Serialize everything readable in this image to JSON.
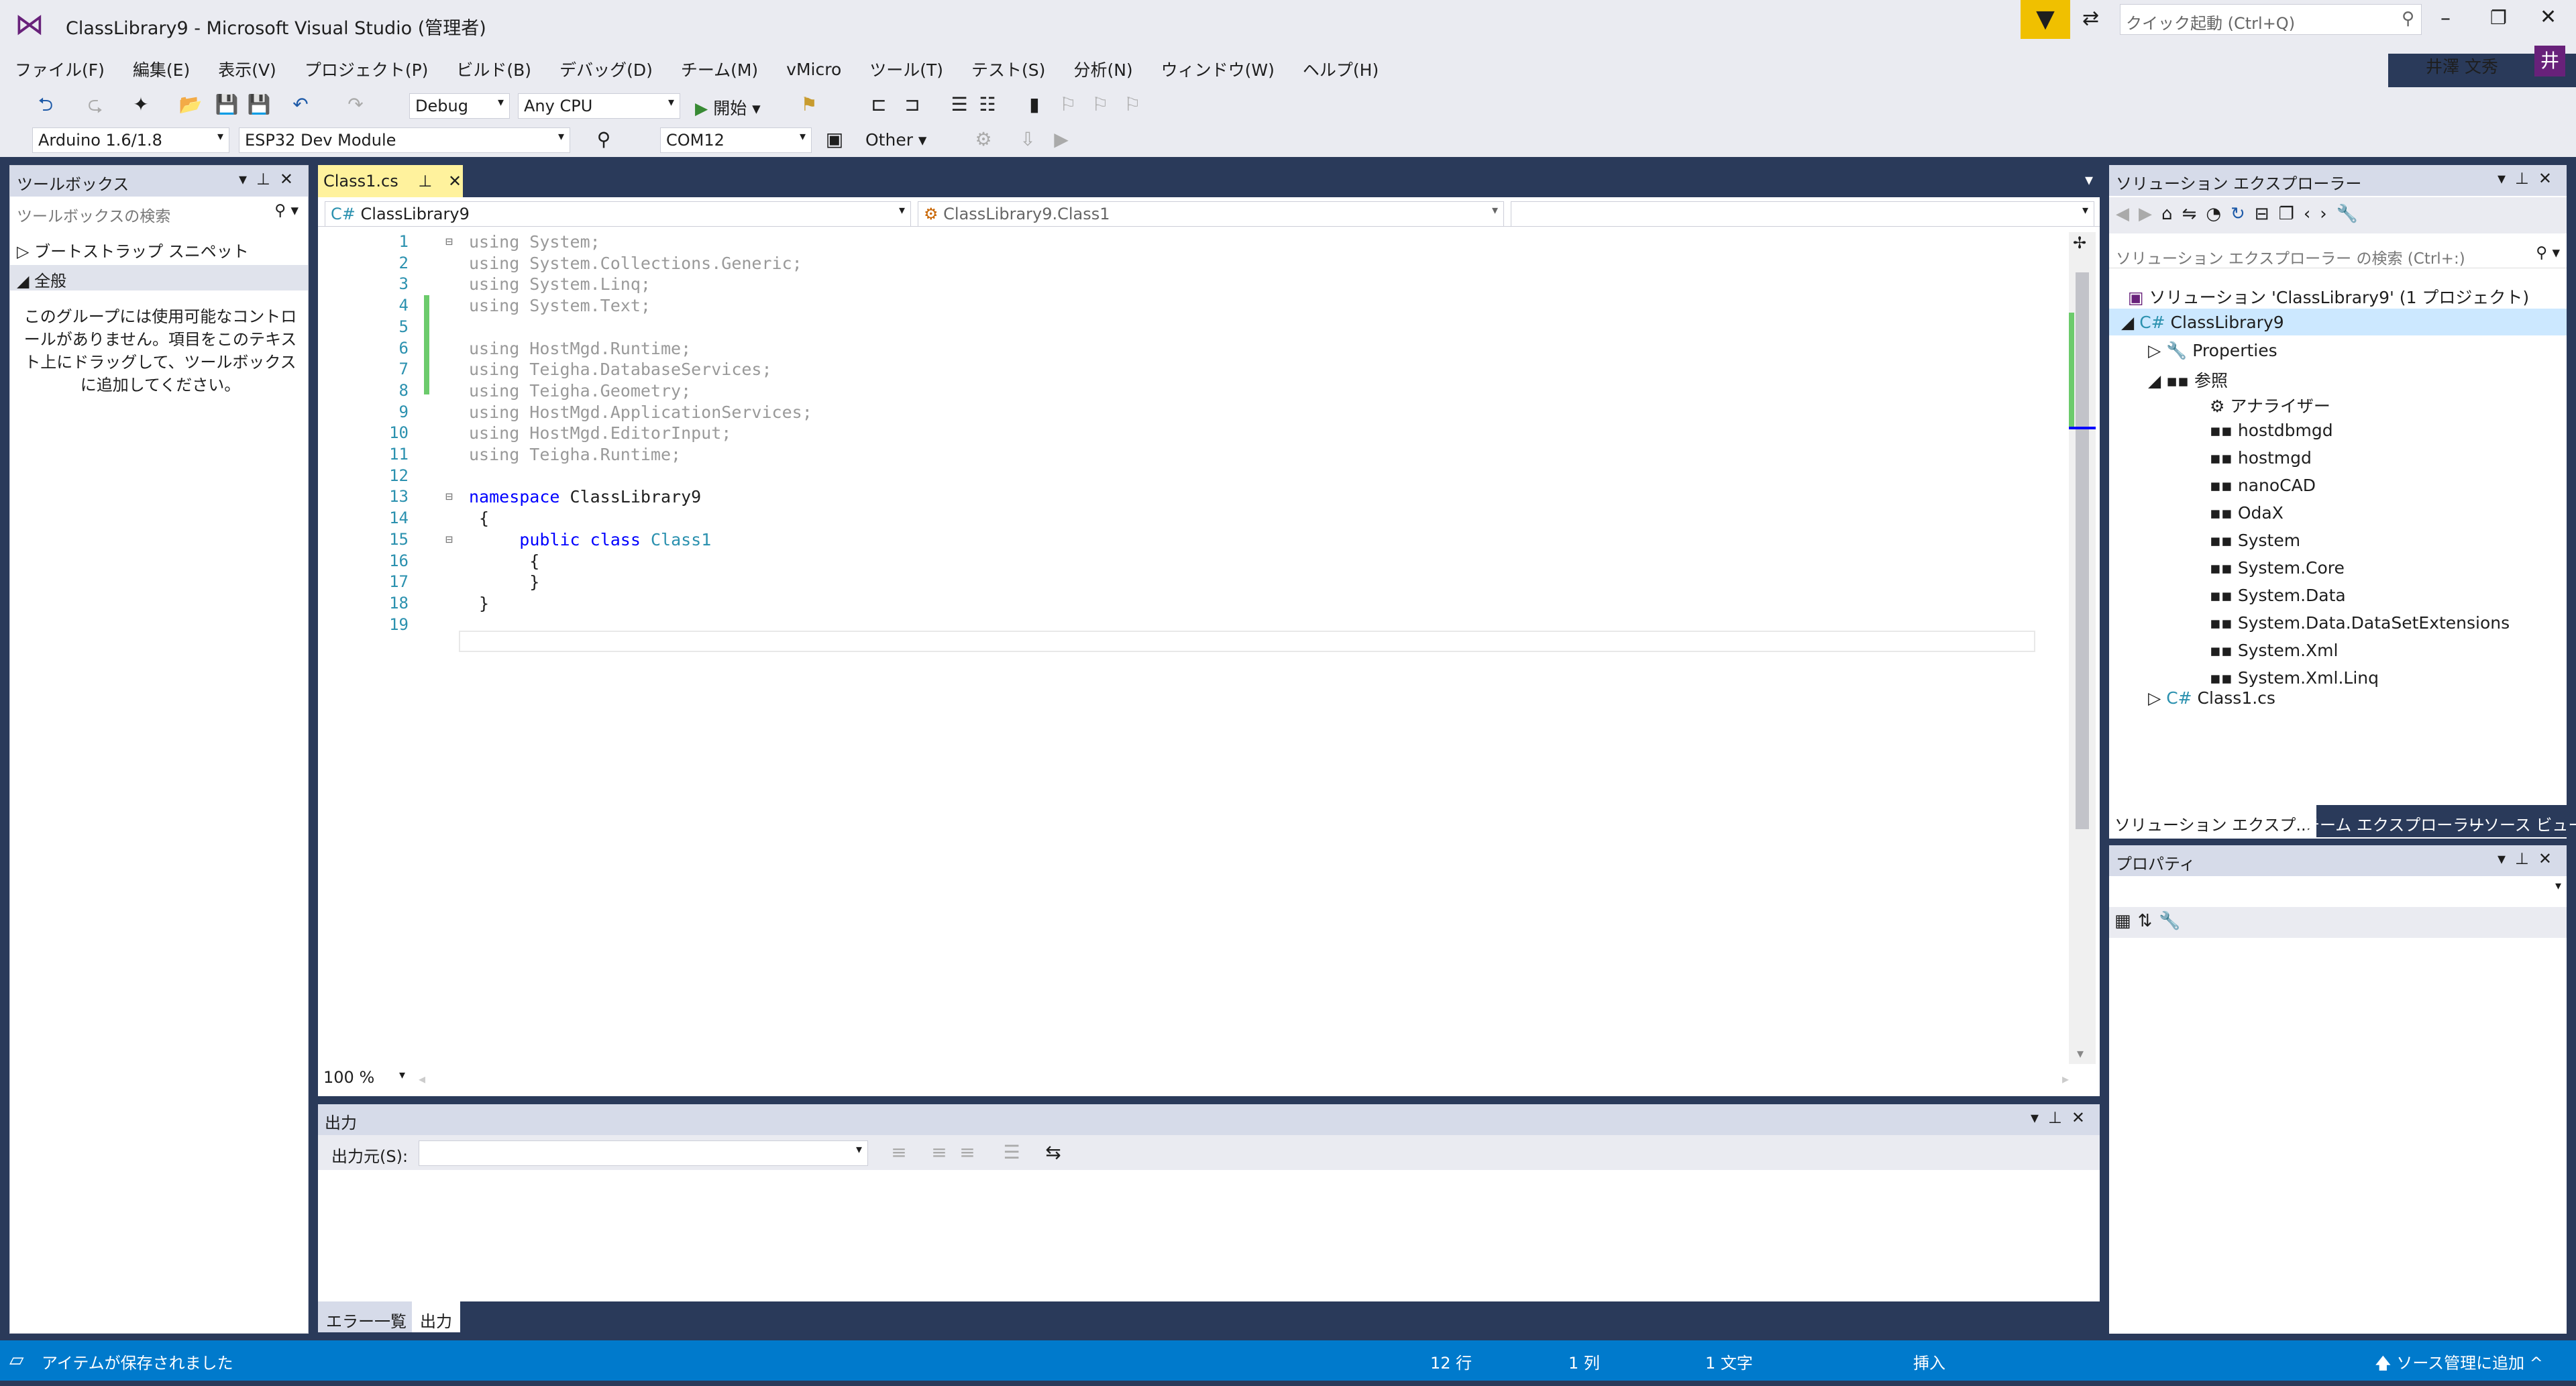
{
  "window": {
    "title": "ClassLibrary9 - Microsoft Visual Studio  (管理者)",
    "quick_launch": "クイック起動 (Ctrl+Q)",
    "user": "井澤 文秀",
    "avatar": "井"
  },
  "menu": [
    "ファイル(F)",
    "編集(E)",
    "表示(V)",
    "プロジェクト(P)",
    "ビルド(B)",
    "デバッグ(D)",
    "チーム(M)",
    "vMicro",
    "ツール(T)",
    "テスト(S)",
    "分析(N)",
    "ウィンドウ(W)",
    "ヘルプ(H)"
  ],
  "toolbar": {
    "config": "Debug",
    "platform": "Any CPU",
    "start": "開始",
    "arduino": "Arduino 1.6/1.8",
    "board": "ESP32 Dev Module",
    "port": "COM12",
    "other": "Other"
  },
  "toolbox": {
    "title": "ツールボックス",
    "search": "ツールボックスの検索",
    "group1": "ブートストラップ スニペット",
    "group2": "全般",
    "empty_msg": "このグループには使用可能なコントロールがありません。項目をこのテキスト上にドラッグして、ツールボックスに追加してください。"
  },
  "editor": {
    "tab": "Class1.cs",
    "nav_project": "ClassLibrary9",
    "nav_class": "ClassLibrary9.Class1",
    "zoom": "100 %",
    "lines": [
      {
        "n": "1",
        "t": "using System;"
      },
      {
        "n": "2",
        "t": "using System.Collections.Generic;"
      },
      {
        "n": "3",
        "t": "using System.Linq;"
      },
      {
        "n": "4",
        "t": "using System.Text;"
      },
      {
        "n": "5",
        "t": ""
      },
      {
        "n": "6",
        "t": "using HostMgd.Runtime;"
      },
      {
        "n": "7",
        "t": "using Teigha.DatabaseServices;"
      },
      {
        "n": "8",
        "t": "using Teigha.Geometry;"
      },
      {
        "n": "9",
        "t": "using HostMgd.ApplicationServices;"
      },
      {
        "n": "10",
        "t": "using HostMgd.EditorInput;"
      },
      {
        "n": "11",
        "t": "using Teigha.Runtime;"
      },
      {
        "n": "12",
        "t": ""
      },
      {
        "n": "13",
        "t": "namespace ClassLibrary9"
      },
      {
        "n": "14",
        "t": " {"
      },
      {
        "n": "15",
        "t": "     public class Class1"
      },
      {
        "n": "16",
        "t": "      {"
      },
      {
        "n": "17",
        "t": "      }"
      },
      {
        "n": "18",
        "t": " }"
      },
      {
        "n": "19",
        "t": ""
      }
    ]
  },
  "output": {
    "title": "出力",
    "source_label": "出力元(S):",
    "tabs": [
      "エラー一覧",
      "出力"
    ]
  },
  "solution": {
    "title": "ソリューション エクスプローラー",
    "search": "ソリューション エクスプローラー の検索 (Ctrl+:)",
    "root": "ソリューション 'ClassLibrary9' (1 プロジェクト)",
    "project": "ClassLibrary9",
    "properties": "Properties",
    "refs": "参照",
    "ref_items": [
      "アナライザー",
      "hostdbmgd",
      "hostmgd",
      "nanoCAD",
      "OdaX",
      "System",
      "System.Core",
      "System.Data",
      "System.Data.DataSetExtensions",
      "System.Xml",
      "System.Xml.Linq"
    ],
    "file": "Class1.cs",
    "tabs": [
      "ソリューション エクスプ...",
      "チーム エクスプローラー",
      "リソース ビュー"
    ]
  },
  "properties": {
    "title": "プロパティ"
  },
  "status": {
    "message": "アイテムが保存されました",
    "line": "12 行",
    "col": "1 列",
    "chars": "1 文字",
    "mode": "挿入",
    "scm": "ソース管理に追加"
  },
  "colors": {
    "accent": "#007acc",
    "vs_purple": "#68217a",
    "tab_yellow": "#fff29d"
  }
}
